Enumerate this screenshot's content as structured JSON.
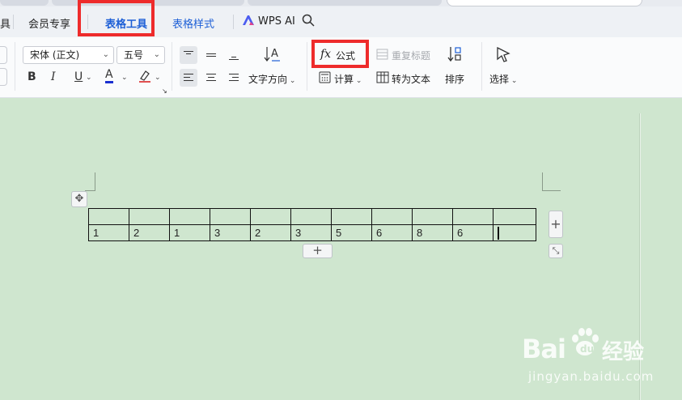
{
  "tabs": {
    "partial": "具",
    "member": "会员专享",
    "table_tools": "表格工具",
    "table_style": "表格样式",
    "wps_ai": "WPS AI"
  },
  "font": {
    "name": "宋体 (正文)",
    "size": "五号"
  },
  "format": {
    "bold": "B",
    "italic": "I",
    "underline": "U",
    "font_color": "A"
  },
  "ribbon": {
    "text_direction": "文字方向",
    "formula_icon": "fx",
    "formula": "公式",
    "repeat_header": "重复标题",
    "sort": "排序",
    "calculate": "计算",
    "to_text": "转为文本",
    "select": "选择"
  },
  "table": {
    "header_row": [
      "",
      "",
      "",
      "",
      "",
      "",
      "",
      "",
      "",
      "",
      ""
    ],
    "data_row": [
      "1",
      "2",
      "1",
      "3",
      "2",
      "3",
      "5",
      "6",
      "8",
      "6",
      ""
    ]
  },
  "handles": {
    "add_col": "+",
    "add_row": "+"
  },
  "watermark": {
    "brand": "Bai",
    "brand2": "经验",
    "url": "jingyan.baidu.com"
  },
  "colors": {
    "accent": "#1d5fd6",
    "highlight": "#ee2b2b",
    "page_bg": "#cfe6cf"
  }
}
